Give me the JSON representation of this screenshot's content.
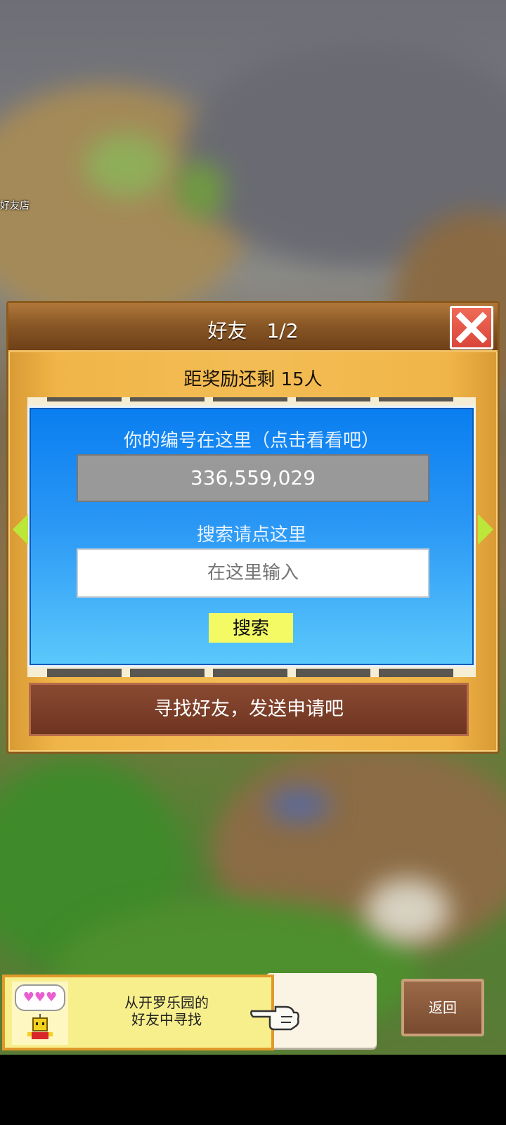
{
  "background": {
    "shop_label": "好友店"
  },
  "dialog": {
    "title": "好友",
    "page_indicator": "1/2",
    "reward_text": "距奖励还剩 15人",
    "id_label": "你的编号在这里（点击看看吧）",
    "player_id": "336,559,029",
    "search_label": "搜索请点这里",
    "search_placeholder": "在这里输入",
    "search_button": "搜索",
    "find_friends_button": "寻找好友，发送申请吧"
  },
  "bottom_bar": {
    "banner_line1": "从开罗乐园的",
    "banner_line2": "好友中寻找",
    "back_button": "返回"
  },
  "colors": {
    "dialog_wood": "#f0b548",
    "header_brown": "#8a5826",
    "panel_blue": "#2a97f5",
    "close_red": "#e0523f",
    "search_button_yellow": "#f3fa64",
    "arrow_green": "#bde63a"
  },
  "icons": [
    "close-icon",
    "chevron-left-icon",
    "chevron-right-icon",
    "hearts-icon",
    "kairobot-icon",
    "pointing-hand-icon"
  ]
}
